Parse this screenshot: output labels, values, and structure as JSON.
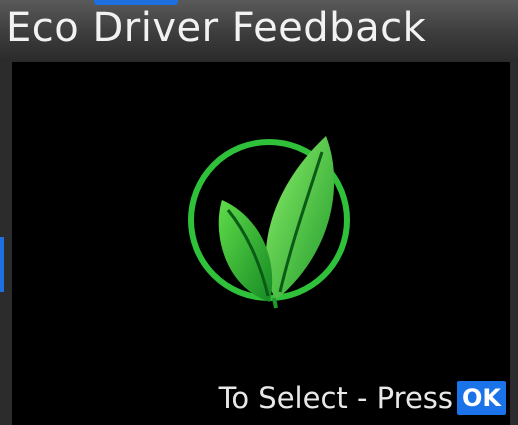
{
  "header": {
    "title": "Eco Driver Feedback"
  },
  "main": {
    "logo_icon": "eco-leaves-icon"
  },
  "footer": {
    "hint_text": "To Select - Press",
    "ok_label": "OK"
  },
  "colors": {
    "accent": "#1a73e8",
    "leaf_green": "#35c73f",
    "background": "#000000"
  }
}
